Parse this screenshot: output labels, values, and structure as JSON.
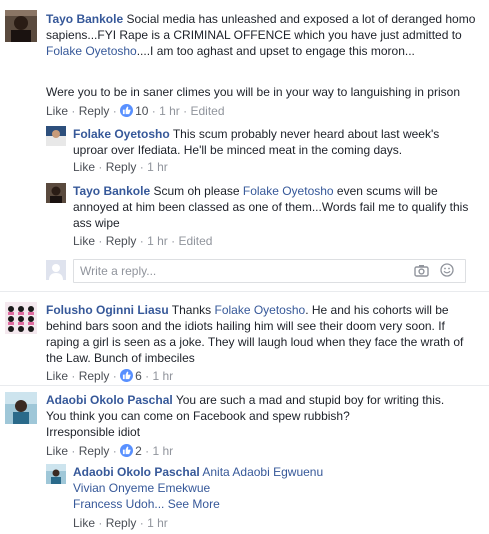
{
  "comments": [
    {
      "author": "Tayo Bankole",
      "text_before": "Social media has unleashed and exposed a lot of deranged homo sapiens...FYI Rape is a CRIMINAL OFFENCE which you have just admitted to ",
      "mention": "Folake Oyetosho",
      "text_after": "....I am too aghast and upset to engage this moron...",
      "text2": "Were you to be in saner climes you will be in your way to languishing in prison",
      "like_label": "Like",
      "reply_label": "Reply",
      "reactions": "10",
      "time": "1 hr",
      "edited": "Edited",
      "replies": [
        {
          "author": "Folake Oyetosho",
          "text": "This scum probably never heard about last week's uproar over Ifediata. He'll be minced meat in the coming days.",
          "like_label": "Like",
          "reply_label": "Reply",
          "time": "1 hr"
        },
        {
          "author": "Tayo Bankole",
          "text_before": "Scum oh please ",
          "mention": "Folake Oyetosho",
          "text_after": " even scums will be annoyed at him been classed as one of them...Words fail me to qualify this ass wipe",
          "like_label": "Like",
          "reply_label": "Reply",
          "time": "1 hr",
          "edited": "Edited"
        }
      ],
      "reply_placeholder": "Write a reply..."
    },
    {
      "author": "Folusho Oginni Liasu",
      "text_before": "Thanks ",
      "mention": "Folake Oyetosho",
      "text_after": ". He and his cohorts will be behind bars soon and the idiots hailing him will see their doom very soon. If raping a girl is seen as a joke. They will laugh loud when they face the wrath of the Law. Bunch of imbeciles",
      "like_label": "Like",
      "reply_label": "Reply",
      "reactions": "6",
      "time": "1 hr"
    },
    {
      "author": "Adaobi Okolo Paschal",
      "text": "You are such a mad and stupid boy for writing this. You think you can come on Facebook and spew rubbish?",
      "text2": "Irresponsible idiot",
      "like_label": "Like",
      "reply_label": "Reply",
      "reactions": "2",
      "time": "1 hr",
      "replies": [
        {
          "author": "Adaobi Okolo Paschal",
          "mention1": "Anita Adaobi Egwuenu",
          "mention2": "Vivian Onyeme Emekwue",
          "mention3": "Francess Udoh",
          "see_more": "... See More",
          "like_label": "Like",
          "reply_label": "Reply",
          "time": "1 hr"
        }
      ]
    }
  ],
  "icons": {
    "camera": "camera-icon",
    "emoji": "emoji-icon",
    "like_badge": "thumbs-up-icon"
  },
  "colors": {
    "link": "#365899",
    "meta": "#90949c",
    "like_badge": "#5890ff"
  }
}
